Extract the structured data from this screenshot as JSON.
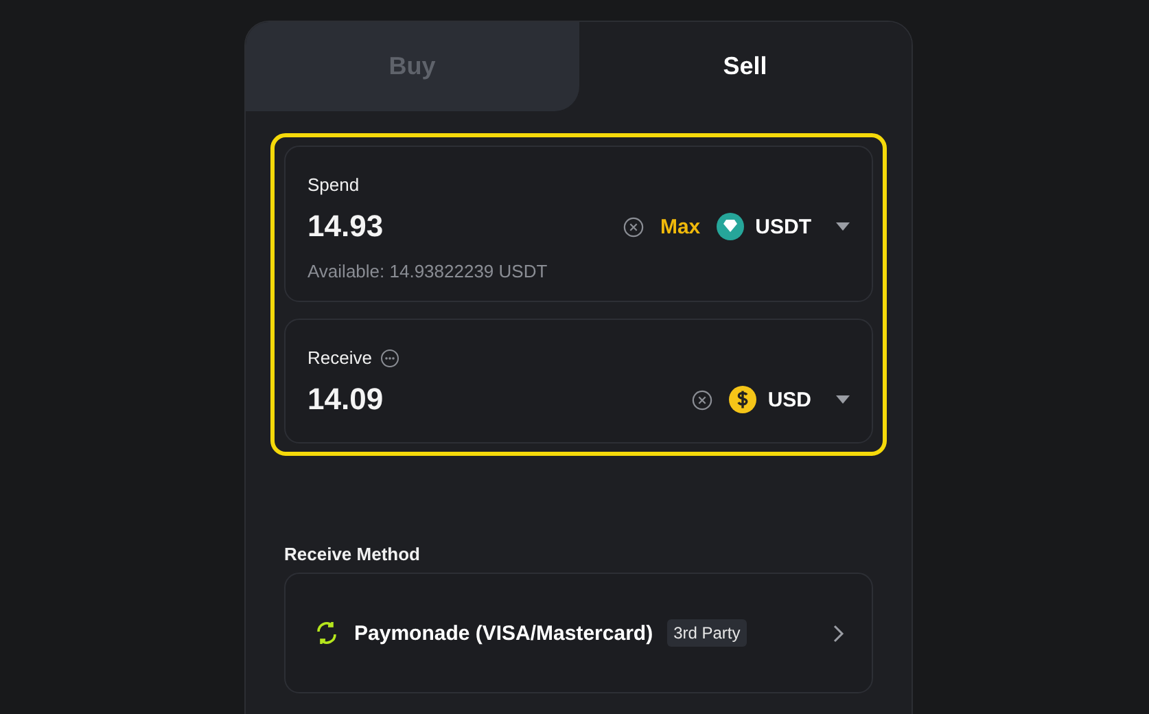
{
  "tabs": [
    {
      "label": "Buy",
      "selected": false
    },
    {
      "label": "Sell",
      "selected": true
    }
  ],
  "highlighted": true,
  "fields": [
    {
      "label": "Spend",
      "info": false,
      "value": "14.93",
      "max": "Max",
      "currency": "USDT",
      "kind": "tether",
      "note": "Available: 14.93822239 USDT"
    },
    {
      "label": "Receive",
      "info": true,
      "value": "14.09",
      "currency": "USD",
      "kind": "dollar"
    }
  ],
  "receive_method": {
    "heading": "Receive Method",
    "name": "Paymonade (VISA/Mastercard)",
    "badge": "3rd Party"
  }
}
